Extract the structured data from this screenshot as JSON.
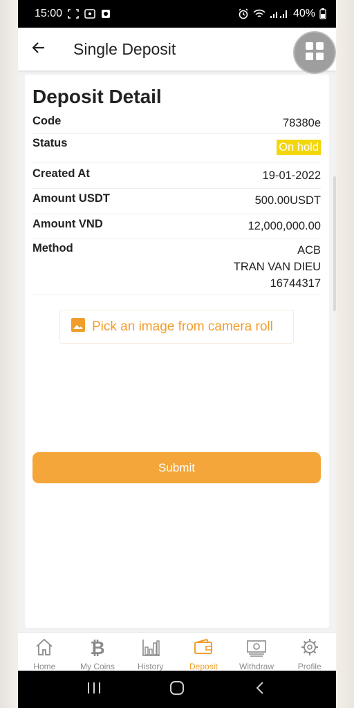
{
  "status_bar": {
    "time": "15:00",
    "battery": "40%"
  },
  "header": {
    "title": "Single Deposit",
    "back_icon": "arrow-left-icon",
    "menu_icon": "grid-icon"
  },
  "card": {
    "title": "Deposit Detail",
    "rows": [
      {
        "label": "Code",
        "value": "78380e"
      },
      {
        "label": "Status",
        "value": "On hold",
        "badge_color": "#f4d60d"
      },
      {
        "label": "Created At",
        "value": "19-01-2022"
      },
      {
        "label": "Amount USDT",
        "value": "500.00USDT"
      },
      {
        "label": "Amount VND",
        "value": "12,000,000.00"
      },
      {
        "label": "Method",
        "value_lines": [
          "ACB",
          "TRAN VAN DIEU",
          "16744317"
        ]
      }
    ],
    "pick_image_label": "Pick an image from camera roll",
    "pick_image_icon": "image-icon",
    "submit_label": "Submit"
  },
  "bottom_nav": {
    "items": [
      {
        "label": "Home",
        "icon": "home-icon"
      },
      {
        "label": "My Coins",
        "icon": "bitcoin-icon"
      },
      {
        "label": "History",
        "icon": "bar-chart-icon"
      },
      {
        "label": "Deposit",
        "icon": "wallet-icon",
        "active": true
      },
      {
        "label": "Withdraw",
        "icon": "cash-icon"
      },
      {
        "label": "Profile",
        "icon": "gear-icon"
      }
    ]
  },
  "colors": {
    "accent": "#f19d2c",
    "submit": "#f4a63a",
    "badge": "#f4d60d"
  }
}
